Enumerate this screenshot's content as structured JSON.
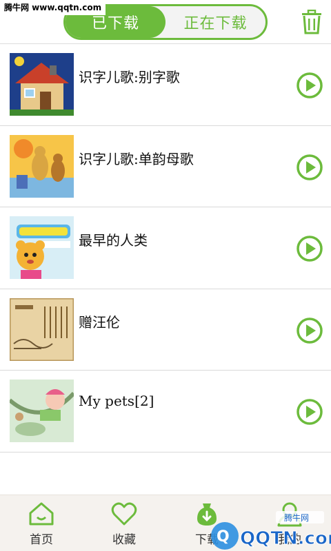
{
  "watermark": {
    "site": "腾牛网 www.qqtn.com",
    "brand": "QQTN.com",
    "brand_cn": "腾牛网"
  },
  "header": {
    "tabs": [
      {
        "label": "已下载",
        "active": true
      },
      {
        "label": "正在下载",
        "active": false
      }
    ],
    "trash_icon": "trash-icon"
  },
  "items": [
    {
      "title": "识字儿歌:别字歌",
      "icon": "play-icon"
    },
    {
      "title": "识字儿歌:单韵母歌",
      "icon": "play-icon"
    },
    {
      "title": "最早的人类",
      "icon": "play-icon"
    },
    {
      "title": "赠汪伦",
      "icon": "play-icon"
    },
    {
      "title": "My pets[2]",
      "icon": "play-icon"
    }
  ],
  "tabbar": [
    {
      "label": "首页",
      "icon": "home-icon"
    },
    {
      "label": "收藏",
      "icon": "heart-icon"
    },
    {
      "label": "下载",
      "icon": "download-icon"
    },
    {
      "label": "我的",
      "icon": "user-icon"
    }
  ],
  "colors": {
    "accent": "#6cbb3c",
    "text": "#111111",
    "divider": "#d9d9d9",
    "tabbar_bg": "#f5f2ee"
  }
}
